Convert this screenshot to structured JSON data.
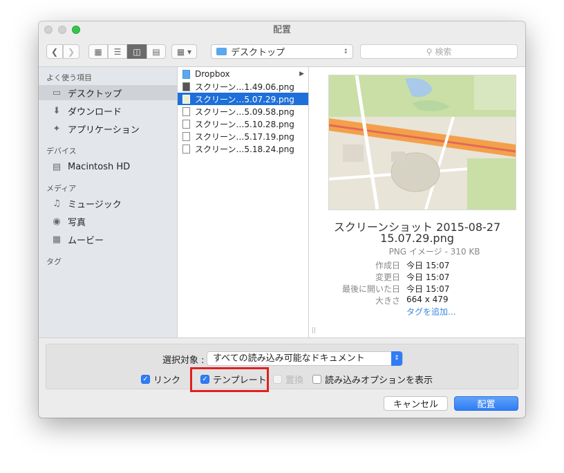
{
  "window": {
    "title": "配置"
  },
  "toolbar": {
    "back_icon": "chevron-left-icon",
    "forward_icon": "chevron-right-icon",
    "location": "デスクトップ",
    "search_placeholder": "検索"
  },
  "sidebar": {
    "favorites_header": "よく使う項目",
    "favorites": [
      {
        "label": "デスクトップ",
        "icon": "desktop-icon",
        "selected": true
      },
      {
        "label": "ダウンロード",
        "icon": "download-icon"
      },
      {
        "label": "アプリケーション",
        "icon": "applications-icon"
      }
    ],
    "devices_header": "デバイス",
    "devices": [
      {
        "label": "Macintosh HD",
        "icon": "hard-drive-icon"
      }
    ],
    "media_header": "メディア",
    "media": [
      {
        "label": "ミュージック",
        "icon": "music-icon"
      },
      {
        "label": "写真",
        "icon": "camera-icon"
      },
      {
        "label": "ムービー",
        "icon": "film-icon"
      }
    ],
    "tags_header": "タグ"
  },
  "files": [
    {
      "name": "Dropbox",
      "type": "folder"
    },
    {
      "name": "スクリーン…1.49.06.png",
      "type": "file"
    },
    {
      "name": "スクリーン…5.07.29.png",
      "type": "file",
      "selected": true
    },
    {
      "name": "スクリーン…5.09.58.png",
      "type": "file"
    },
    {
      "name": "スクリーン…5.10.28.png",
      "type": "file"
    },
    {
      "name": "スクリーン…5.17.19.png",
      "type": "file"
    },
    {
      "name": "スクリーン…5.18.24.png",
      "type": "file"
    }
  ],
  "preview": {
    "title_line1": "スクリーンショット 2015-08-27",
    "title_line2": "15.07.29.png",
    "type_size": "PNG イメージ - 310 KB",
    "meta": [
      {
        "key": "作成日",
        "value": "今日 15:07"
      },
      {
        "key": "変更日",
        "value": "今日 15:07"
      },
      {
        "key": "最後に開いた日",
        "value": "今日 15:07"
      },
      {
        "key": "大きさ",
        "value": "664 x 479"
      }
    ],
    "add_tags": "タグを追加..."
  },
  "options": {
    "enable_label": "選択対象 :",
    "enable_value": "すべての読み込み可能なドキュメント",
    "link_label": "リンク",
    "template_label": "テンプレート",
    "replace_label": "置換",
    "show_import_label": "読み込みオプションを表示"
  },
  "buttons": {
    "cancel": "キャンセル",
    "place": "配置"
  },
  "colors": {
    "accent": "#2f7cf6",
    "highlight": "#e0201f"
  }
}
